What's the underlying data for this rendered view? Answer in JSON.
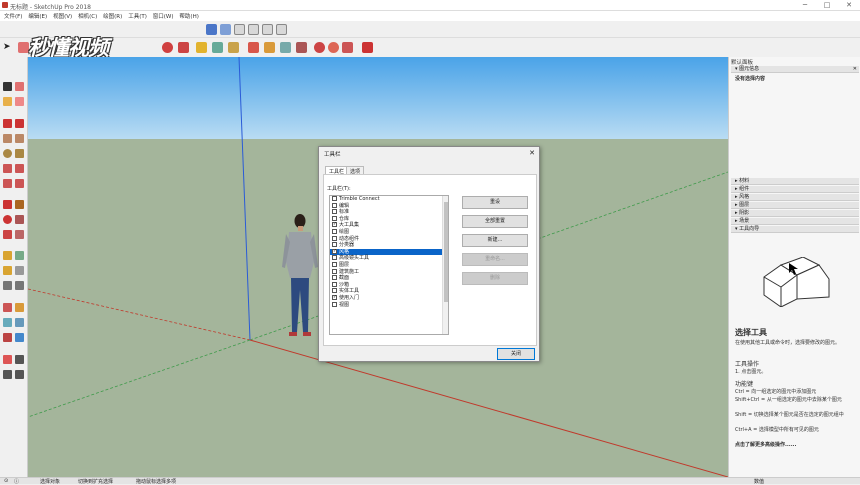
{
  "window": {
    "title": "无标题 - SketchUp Pro 2018",
    "minimize_icon": "minimize-icon",
    "maximize_icon": "maximize-icon",
    "close_icon": "close-icon"
  },
  "menu": {
    "items": [
      "文件(F)",
      "编辑(E)",
      "视图(V)",
      "相机(C)",
      "绘图(R)",
      "工具(T)",
      "窗口(W)",
      "帮助(H)"
    ]
  },
  "watermark": {
    "text": "秒懂视频"
  },
  "tray": {
    "title": "默认面板",
    "entity_info": {
      "header": "图元信息",
      "status": "没有选择内容"
    },
    "collapsed_sections": [
      "材料",
      "组件",
      "风格",
      "图层",
      "阴影",
      "场景"
    ],
    "instructor": {
      "header": "工具向导",
      "tool_title": "选择工具",
      "tool_desc": "在使用其他工具或命令时，选择要修改的图元。",
      "ops_title": "工具操作",
      "ops_line1": "1. 点击图元。",
      "keys_title": "功能键",
      "keys_line1": "Ctrl = 向一组选定的图元中添加图元",
      "keys_line2": "Shift+Ctrl = 从一组选定的图元中去除某个图元",
      "keys_line3": "Shift = 切换选择某个图元是否在选定的图元组中",
      "keys_line4": "Ctrl+A = 选择模型中所有可见的图元",
      "advanced": "点击了解更多高级操作......"
    }
  },
  "dialog": {
    "title": "工具栏",
    "tabs": [
      "工具栏",
      "选项"
    ],
    "group_label": "工具栏(T):",
    "items": [
      {
        "label": "Trimble Connect",
        "checked": false,
        "selected": false
      },
      {
        "label": "编辑",
        "checked": false,
        "selected": false
      },
      {
        "label": "标准",
        "checked": false,
        "selected": false
      },
      {
        "label": "仓库",
        "checked": false,
        "selected": false
      },
      {
        "label": "大工具集",
        "checked": true,
        "selected": false
      },
      {
        "label": "绘图",
        "checked": false,
        "selected": false
      },
      {
        "label": "动态组件",
        "checked": false,
        "selected": false
      },
      {
        "label": "分类器",
        "checked": false,
        "selected": false
      },
      {
        "label": "风格",
        "checked": true,
        "selected": true
      },
      {
        "label": "高级镜头工具",
        "checked": false,
        "selected": false
      },
      {
        "label": "图层",
        "checked": false,
        "selected": false
      },
      {
        "label": "建筑施工",
        "checked": false,
        "selected": false
      },
      {
        "label": "截面",
        "checked": false,
        "selected": false
      },
      {
        "label": "沙箱",
        "checked": false,
        "selected": false
      },
      {
        "label": "实体工具",
        "checked": false,
        "selected": false
      },
      {
        "label": "使用入门",
        "checked": true,
        "selected": false
      },
      {
        "label": "视图",
        "checked": false,
        "selected": false
      }
    ],
    "buttons": {
      "reset": "重设",
      "reset_all": "全部重置",
      "new": "新建...",
      "rename": "重命名...",
      "delete": "删除",
      "close": "关闭"
    }
  },
  "statusbar": {
    "hint1": "选择对象",
    "hint2": "切换到扩充选择",
    "hint3": "拖动鼠标选择多项",
    "measure_label": "数值"
  },
  "colors": {
    "sky_top": "#4aa3e8",
    "ground": "#a4b59b",
    "selection": "#0a64c8",
    "red_axis": "#c0392b",
    "green_axis": "#3e9a4a",
    "blue_axis": "#2a5bd7"
  }
}
